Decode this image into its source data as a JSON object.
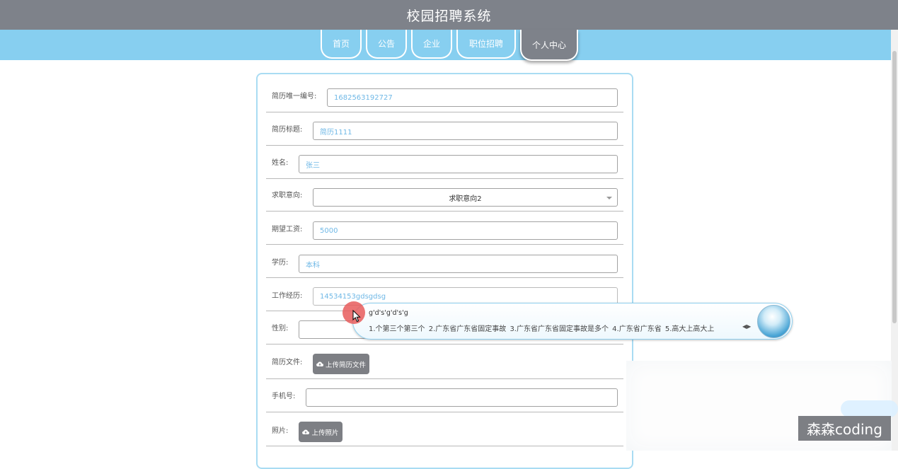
{
  "app": {
    "title": "校园招聘系统"
  },
  "nav": [
    {
      "label": "首页"
    },
    {
      "label": "公告"
    },
    {
      "label": "企业"
    },
    {
      "label": "职位招聘"
    },
    {
      "label": "个人中心"
    }
  ],
  "form": {
    "resume_id": {
      "label": "简历唯一编号:",
      "value": "1682563192727"
    },
    "resume_title": {
      "label": "简历标题:",
      "value": "简历1111"
    },
    "name": {
      "label": "姓名:",
      "value": "张三"
    },
    "job_intention": {
      "label": "求职意向:",
      "value": "求职意向2"
    },
    "expected_salary": {
      "label": "期望工资:",
      "value": "5000"
    },
    "education": {
      "label": "学历:",
      "value": "本科"
    },
    "work_experience": {
      "label": "工作经历:",
      "value": "14534153gdsgdsg"
    },
    "gender": {
      "label": "性别:",
      "value": ""
    },
    "resume_file": {
      "label": "简历文件:",
      "button": "上传简历文件"
    },
    "phone": {
      "label": "手机号:",
      "value": ""
    },
    "photo": {
      "label": "照片:",
      "button": "上传照片"
    }
  },
  "ime": {
    "composition": "g'd's'g'd's'g",
    "candidates": "1.个第三个第三个    2.广东省广东省固定事故    3.广东省广东省固定事故是多个    4.广东省广东省    5.高大上高大上"
  },
  "watermark": "森森coding",
  "colors": {
    "topbar": "#7e828a",
    "navbar": "#87cff0",
    "value_text": "#6fb8e6",
    "card_border": "#a9dcf3"
  }
}
